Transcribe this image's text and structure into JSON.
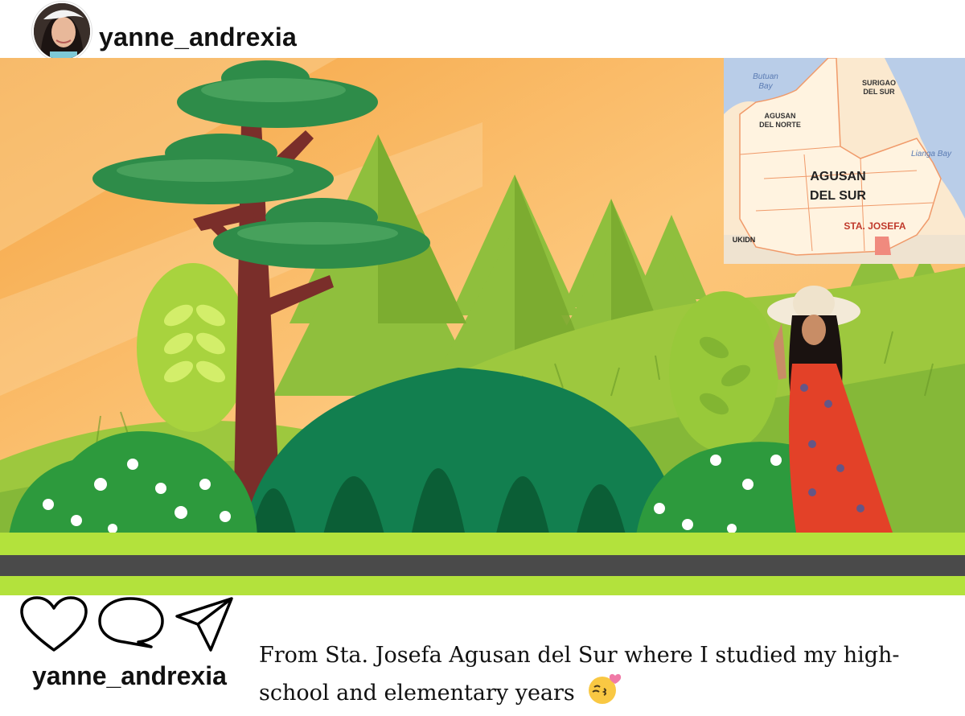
{
  "post": {
    "username": "yanne_andrexia",
    "caption_line1": "From Sta. Josefa Agusan del Sur where I studied my high-",
    "caption_line2": "school and elementary years",
    "caption_emoji": "kissing-face-with-heart-emoji"
  },
  "map": {
    "labels": {
      "butuan_bay_1": "Butuan",
      "butuan_bay_2": "Bay",
      "agusan_norte_1": "AGUSAN",
      "agusan_norte_2": "DEL NORTE",
      "surigao_1": "SURIGAO",
      "surigao_2": "DEL SUR",
      "lianga": "Lianga Bay",
      "agusan_sur_1": "AGUSAN",
      "agusan_sur_2": "DEL SUR",
      "sta_josefa": "STA. JOSEFA",
      "bukidnon": "UKIDN"
    }
  },
  "icons": {
    "like": "heart-icon",
    "comment": "comment-bubble-icon",
    "share": "paper-plane-icon"
  },
  "colors": {
    "sky_top": "#f6a94a",
    "sky_bottom": "#fbd08a",
    "grass_light": "#b3e23c",
    "road": "#4a4a4a",
    "map_land": "#fbe9cf",
    "map_water": "#b9cde8",
    "map_highlight": "#f08a7e"
  }
}
